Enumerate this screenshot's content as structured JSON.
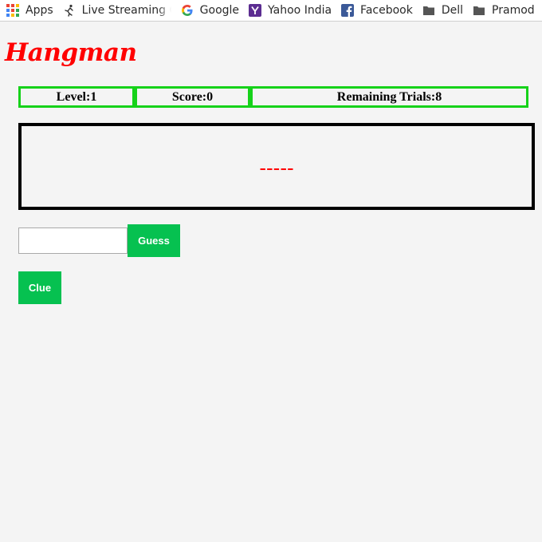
{
  "bookmarks": [
    {
      "label": "Apps",
      "icon": "apps-grid-icon"
    },
    {
      "label": "Live Streaming Cricket",
      "icon": "runner-icon"
    },
    {
      "label": "Google",
      "icon": "google-g-icon"
    },
    {
      "label": "Yahoo India",
      "icon": "yahoo-y-icon"
    },
    {
      "label": "Facebook",
      "icon": "facebook-f-icon"
    },
    {
      "label": "Dell",
      "icon": "folder-icon"
    },
    {
      "label": "Pramod",
      "icon": "folder-icon"
    }
  ],
  "game": {
    "title": "Hangman",
    "level": "Level:1",
    "score": "Score:0",
    "remaining": "Remaining Trials:8",
    "word": "-----",
    "guess_value": "",
    "guess_label": "Guess",
    "clue_label": "Clue"
  },
  "colors": {
    "title": "#ff0000",
    "stat_border": "#16d21a",
    "word": "#ff0000",
    "button_bg": "#06c150",
    "page_bg": "#f4f4f4"
  }
}
